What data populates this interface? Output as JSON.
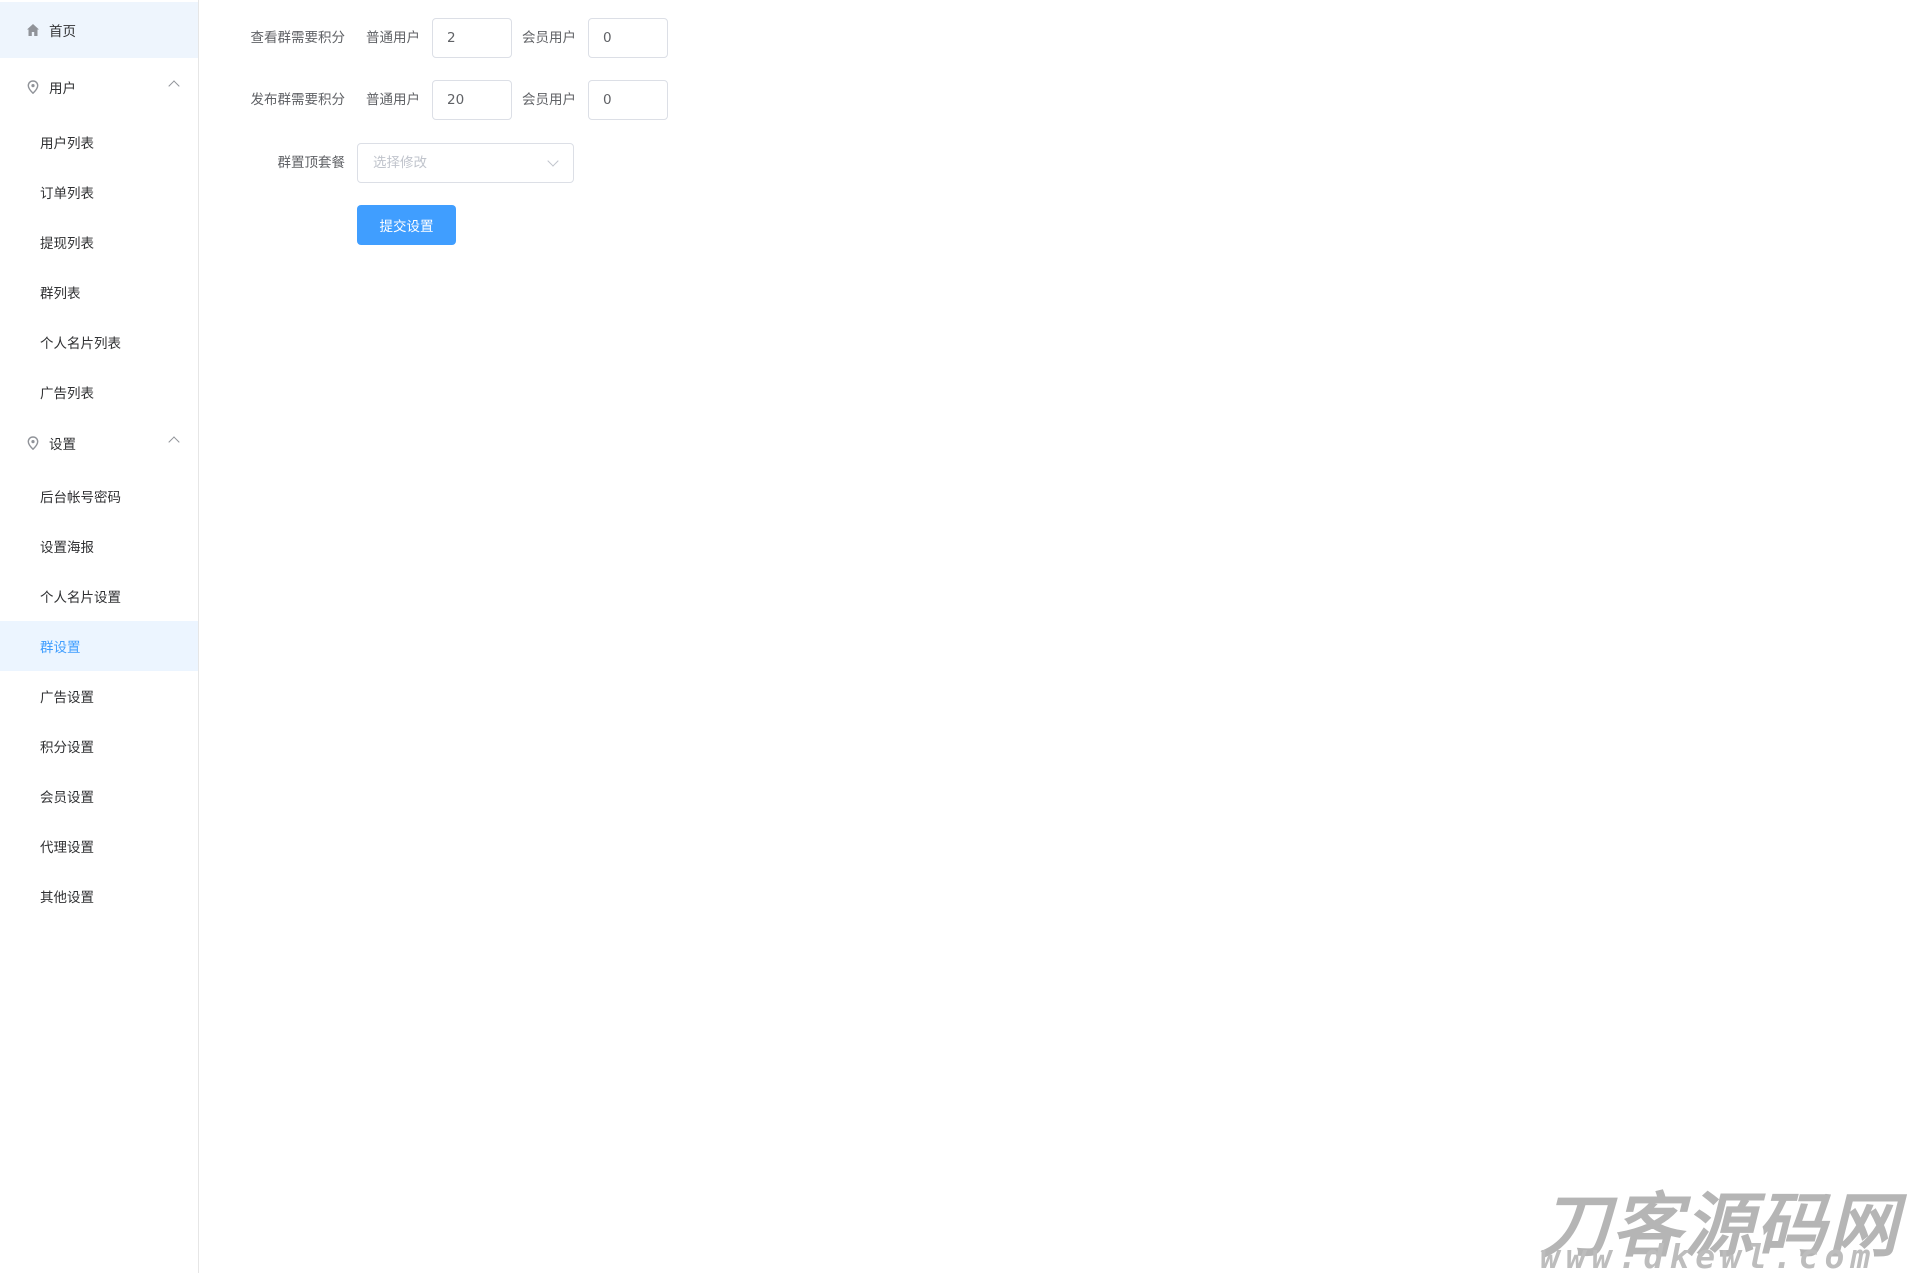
{
  "sidebar": {
    "home": {
      "label": "首页",
      "icon": "home-icon"
    },
    "group_user": {
      "label": "用户",
      "icon": "location-icon"
    },
    "user_items": [
      {
        "label": "用户列表"
      },
      {
        "label": "订单列表"
      },
      {
        "label": "提现列表"
      },
      {
        "label": "群列表"
      },
      {
        "label": "个人名片列表"
      },
      {
        "label": "广告列表"
      }
    ],
    "group_settings": {
      "label": "设置",
      "icon": "location-icon"
    },
    "settings_items": [
      {
        "label": "后台帐号密码"
      },
      {
        "label": "设置海报"
      },
      {
        "label": "个人名片设置"
      },
      {
        "label": "群设置",
        "active": true
      },
      {
        "label": "广告设置"
      },
      {
        "label": "积分设置"
      },
      {
        "label": "会员设置"
      },
      {
        "label": "代理设置"
      },
      {
        "label": "其他设置"
      }
    ]
  },
  "form": {
    "view_points": {
      "label": "查看群需要积分",
      "normal_label": "普通用户",
      "normal_value": "2",
      "member_label": "会员用户",
      "member_value": "0"
    },
    "post_points": {
      "label": "发布群需要积分",
      "normal_label": "普通用户",
      "normal_value": "20",
      "member_label": "会员用户",
      "member_value": "0"
    },
    "top_package": {
      "label": "群置顶套餐",
      "placeholder": "选择修改"
    },
    "submit_label": "提交设置"
  },
  "watermark": {
    "title": "刀客源码网",
    "url": "www.dkewl.com"
  },
  "colors": {
    "primary": "#409eff",
    "active_bg": "#ecf5ff"
  }
}
